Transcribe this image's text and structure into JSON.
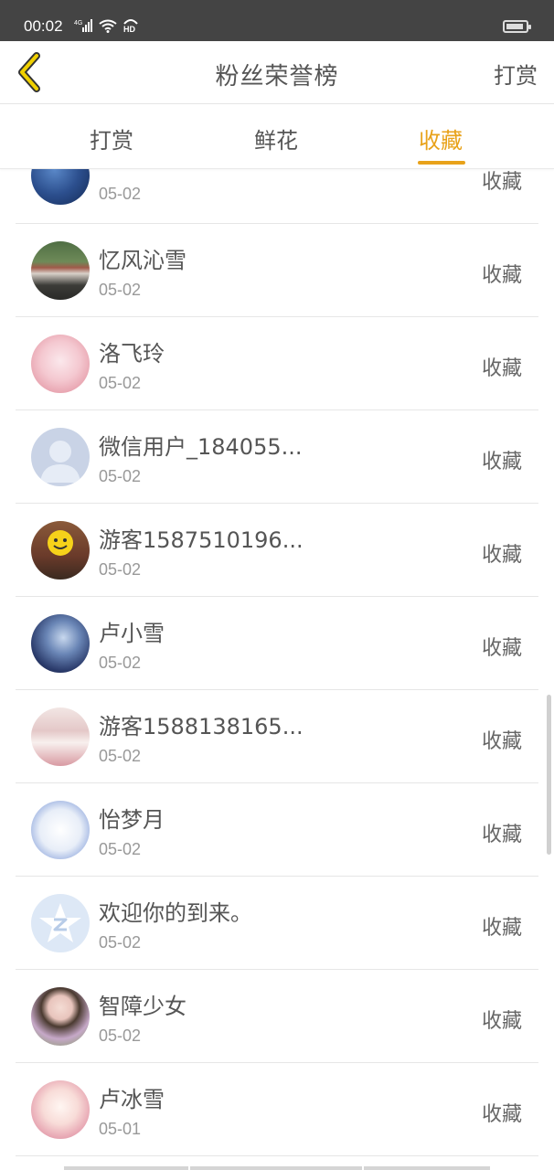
{
  "status_bar": {
    "time": "00:02",
    "network": "4G",
    "hd": "HD"
  },
  "header": {
    "title": "粉丝荣誉榜",
    "right_link": "打赏"
  },
  "tabs": [
    {
      "label": "打赏",
      "active": false
    },
    {
      "label": "鲜花",
      "active": false
    },
    {
      "label": "收藏",
      "active": true
    }
  ],
  "colors": {
    "accent": "#e8a21a",
    "status_bar": "#444444",
    "text": "#555555",
    "muted": "#999999"
  },
  "list": [
    {
      "name": "",
      "date": "05-02",
      "action": "收藏",
      "avatar": "galaxy-avatar"
    },
    {
      "name": "忆风沁雪",
      "date": "05-02",
      "action": "收藏",
      "avatar": "street-photo-avatar"
    },
    {
      "name": "洛飞玲",
      "date": "05-02",
      "action": "收藏",
      "avatar": "pink-anime-avatar"
    },
    {
      "name": "微信用户_184055...",
      "date": "05-02",
      "action": "收藏",
      "avatar": "default-user-avatar"
    },
    {
      "name": "游客1587510196...",
      "date": "05-02",
      "action": "收藏",
      "avatar": "smiley-balloon-avatar"
    },
    {
      "name": "卢小雪",
      "date": "05-02",
      "action": "收藏",
      "avatar": "blue-anime-avatar"
    },
    {
      "name": "游客1588138165...",
      "date": "05-02",
      "action": "收藏",
      "avatar": "pink-room-avatar"
    },
    {
      "name": "怡梦月",
      "date": "05-02",
      "action": "收藏",
      "avatar": "twin-anime-avatar"
    },
    {
      "name": "欢迎你的到来。",
      "date": "05-02",
      "action": "收藏",
      "avatar": "qq-star-avatar"
    },
    {
      "name": "智障少女",
      "date": "05-02",
      "action": "收藏",
      "avatar": "girl-photo-avatar"
    },
    {
      "name": "卢冰雪",
      "date": "05-01",
      "action": "收藏",
      "avatar": "white-hair-anime-avatar"
    }
  ]
}
